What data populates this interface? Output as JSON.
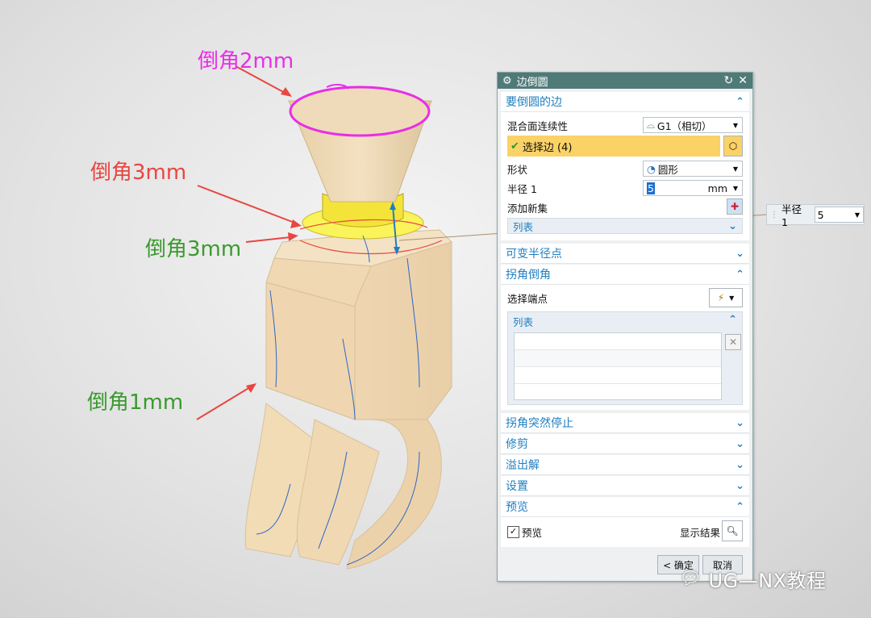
{
  "annotations": {
    "top_label": "倒角2mm",
    "mid_label_red": "倒角3mm",
    "mid_label_green": "倒角3mm",
    "bottom_label": "倒角1mm"
  },
  "dialog": {
    "title": "边倒圆",
    "sec_edges": {
      "title": "要倒圆的边",
      "continuity_label": "混合面连续性",
      "continuity_value": "G1（相切）",
      "select_edge_label": "选择边 (4)",
      "shape_label": "形状",
      "shape_value": "圆形",
      "radius_label": "半径 1",
      "radius_value": "5",
      "radius_unit": "mm",
      "add_set_label": "添加新集",
      "list_label": "列表"
    },
    "sec_variable": {
      "title": "可变半径点"
    },
    "sec_corner": {
      "title": "拐角倒角",
      "select_endpoint_label": "选择端点",
      "list_label": "列表"
    },
    "sec_corner_stop": {
      "title": "拐角突然停止"
    },
    "sec_trim": {
      "title": "修剪"
    },
    "sec_overflow": {
      "title": "溢出解"
    },
    "sec_settings": {
      "title": "设置"
    },
    "sec_preview": {
      "title": "预览",
      "preview_label": "预览",
      "show_result_label": "显示结果"
    },
    "ok_label": "< 确定",
    "cancel_label": "取消"
  },
  "float_radius": {
    "label": "半径 1",
    "value": "5"
  },
  "watermark": "UG—NX教程",
  "colors": {
    "titlebar": "#507a78",
    "accent": "#1f7fc0",
    "highlight": "#fbd266",
    "magenta": "#e82ee6",
    "red": "#e84640",
    "green": "#3a9a2e"
  }
}
